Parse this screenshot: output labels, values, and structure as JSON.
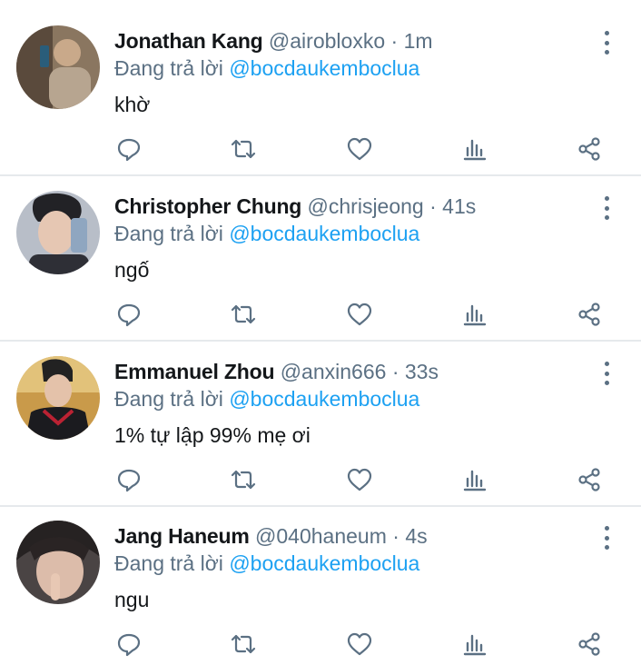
{
  "tweets": [
    {
      "name": "Jonathan Kang",
      "handle": "@airobloxko",
      "separator": "·",
      "time": "1m",
      "reply_prefix": "Đang trả lời",
      "reply_to": "@bocdaukemboclua",
      "text": "khờ",
      "avatar_colors": [
        "#6b5a4a",
        "#b9a58c"
      ]
    },
    {
      "name": "Christopher Chung",
      "handle": "@chrisjeong",
      "separator": "·",
      "time": "41s",
      "reply_prefix": "Đang trả lời",
      "reply_to": "@bocdaukemboclua",
      "text": "ngố",
      "avatar_colors": [
        "#c9ced6",
        "#2e2f36"
      ]
    },
    {
      "name": "Emmanuel Zhou",
      "handle": "@anxin666",
      "separator": "·",
      "time": "33s",
      "reply_prefix": "Đang trả lời",
      "reply_to": "@bocdaukemboclua",
      "text": "1% tự lập 99% mẹ ơi",
      "avatar_colors": [
        "#d9a441",
        "#1b1b1f"
      ]
    },
    {
      "name": "Jang Haneum",
      "handle": "@040haneum",
      "separator": "·",
      "time": "4s",
      "reply_prefix": "Đang trả lời",
      "reply_to": "@bocdaukemboclua",
      "text": "ngu",
      "avatar_colors": [
        "#3a3636",
        "#d9b9a8"
      ]
    }
  ],
  "action_icons": [
    "reply-icon",
    "retweet-icon",
    "like-icon",
    "analytics-icon",
    "share-icon"
  ],
  "colors": {
    "text": "#14171a",
    "secondary": "#5b7083",
    "accent": "#1da1f2",
    "divider": "#e6e9ec"
  }
}
